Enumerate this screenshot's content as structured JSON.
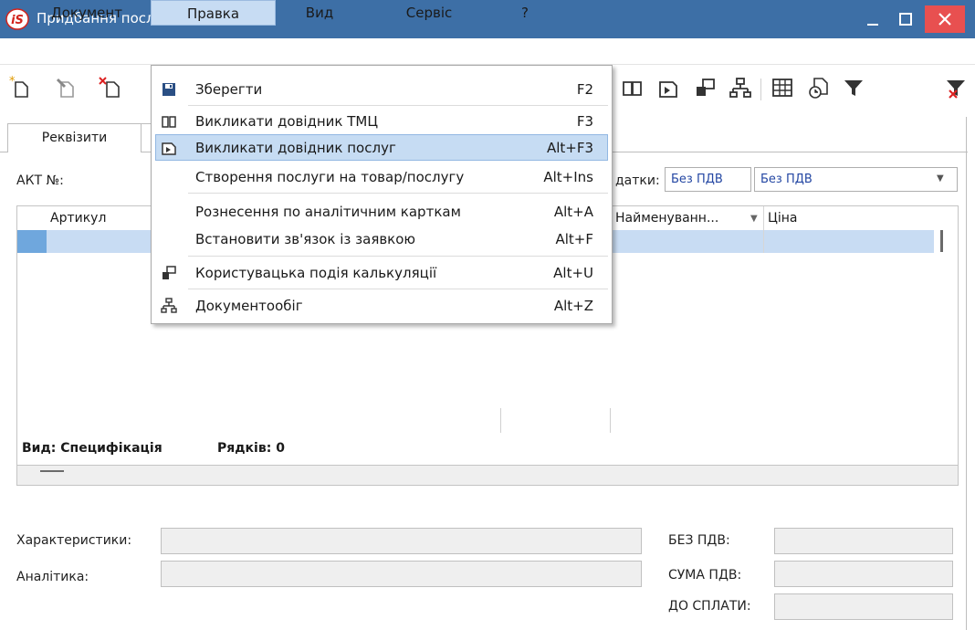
{
  "window": {
    "title": "Придбання послуг",
    "logo_text": "iS"
  },
  "menubar": {
    "document": "Документ",
    "edit": "Правка",
    "view": "Вид",
    "service": "Сервіс",
    "help": "?"
  },
  "tabs": {
    "requisites": "Реквізити"
  },
  "form": {
    "act_label": "АКТ №:",
    "tax_label": "датки:",
    "tax_value1": "Без ПДВ",
    "tax_value2": "Без ПДВ"
  },
  "grid": {
    "columns": {
      "article": "Артикул",
      "name": "Найменуванн...",
      "price": "Ціна"
    },
    "view_label": "Вид: Специфікація",
    "rows_label": "Рядків: 0"
  },
  "bottom": {
    "characteristics": "Характеристики:",
    "analytics": "Аналітика:",
    "no_vat": "БЕЗ ПДВ:",
    "vat_sum": "СУМА ПДВ:",
    "to_pay": "ДО СПЛАТИ:"
  },
  "edit_menu": {
    "items": [
      {
        "label": "Зберегти",
        "key": "F2",
        "icon": "save-icon"
      },
      {
        "label": "Викликати довідник ТМЦ",
        "key": "F3",
        "icon": "book-icon"
      },
      {
        "label": "Викликати довідник послуг",
        "key": "Alt+F3",
        "icon": "service-catalog-icon"
      },
      {
        "label": "Створення послуги на товар/послугу",
        "key": "Alt+Ins"
      },
      {
        "label": "Рознесення по аналітичним карткам",
        "key": "Alt+A"
      },
      {
        "label": "Встановити зв'язок із заявкою",
        "key": "Alt+F"
      },
      {
        "label": "Користувацька подія калькуляції",
        "key": "Alt+U",
        "icon": "user-event-icon"
      },
      {
        "label": "Документообіг",
        "key": "Alt+Z",
        "icon": "workflow-icon"
      }
    ]
  },
  "colors": {
    "titlebar": "#3d6fa6",
    "close": "#e85050",
    "highlight": "#c6dcf3",
    "link_text": "#2447a3"
  }
}
